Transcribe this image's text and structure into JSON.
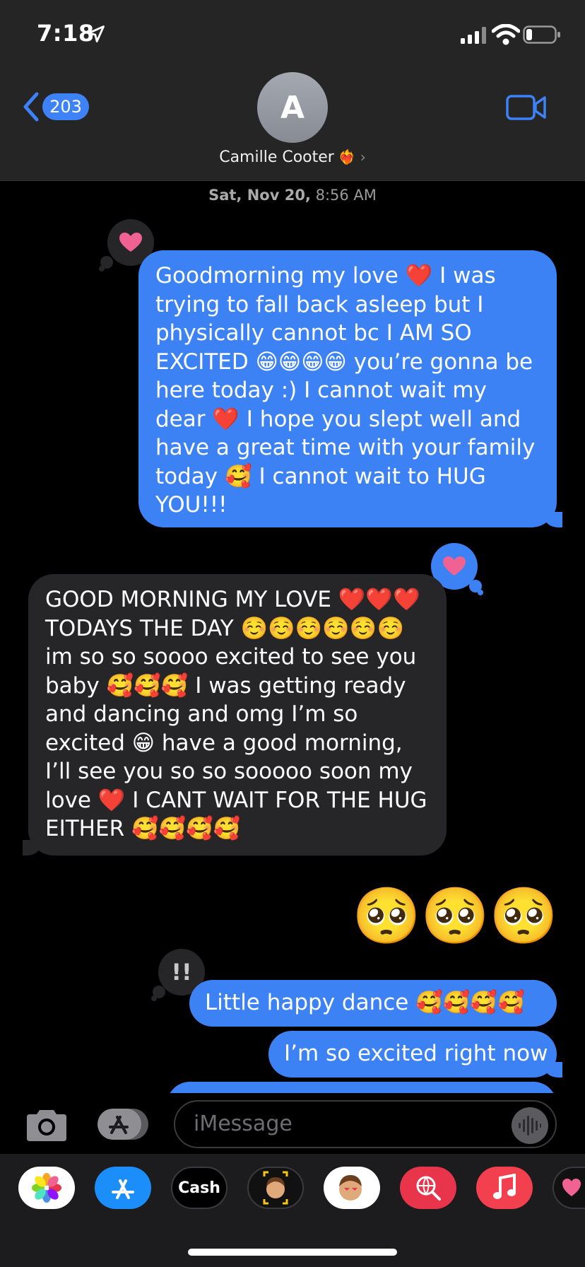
{
  "status_bar": {
    "time": "7:18"
  },
  "header": {
    "back_count": "203",
    "avatar_initial": "A",
    "contact_name": "Camille Cooter",
    "contact_emoji": "❤️‍🔥"
  },
  "thread": {
    "timestamp_date": "Sat, Nov 20,",
    "timestamp_time": "8:56 AM",
    "messages": [
      {
        "direction": "sent",
        "text": "Goodmorning my love ❤️ I was trying to fall back asleep but I physically cannot bc I AM SO EXCITED 😁😁😁😁 you’re gonna be here today :) I cannot wait my dear ❤️ I hope you slept well and have a great time with your family today 🥰 I cannot wait to HUG YOU!!!",
        "tapback": "heart"
      },
      {
        "direction": "received",
        "text": "GOOD MORNING MY LOVE ❤️❤️❤️ TODAYS THE DAY ☺️☺️☺️☺️☺️☺️ im so so soooo excited to see you baby 🥰🥰🥰 I was getting ready and dancing and omg I’m so excited 😁 have a good morning, I’ll see you so so sooooo soon my love ❤️ I CANT WAIT FOR THE HUG EITHER 🥰🥰🥰🥰",
        "tapback": "heart"
      },
      {
        "direction": "sent",
        "text": "🥺🥺🥺",
        "big_emoji": true
      },
      {
        "direction": "sent",
        "text": "Little happy dance 🥰🥰🥰🥰",
        "tapback": "exclamation"
      },
      {
        "direction": "sent",
        "text": "I’m so excited right now"
      }
    ]
  },
  "input": {
    "placeholder": "iMessage"
  },
  "drawer": {
    "apps": [
      {
        "name": "photos",
        "icon": "photos-icon",
        "color": "#ffffff"
      },
      {
        "name": "app-store",
        "icon": "app-store-icon",
        "color": "#1c8ef9"
      },
      {
        "name": "apple-cash",
        "label": "Cash",
        "icon": "apple-cash-icon",
        "color": "#000000"
      },
      {
        "name": "memoji",
        "icon": "memoji-icon",
        "color": "#111111"
      },
      {
        "name": "memoji-stickers",
        "icon": "memoji-stickers-icon",
        "color": "#ffffff"
      },
      {
        "name": "search-images",
        "icon": "images-search-icon",
        "color": "#e8354b"
      },
      {
        "name": "music",
        "icon": "music-icon",
        "color": "#f2404e"
      },
      {
        "name": "digital-touch",
        "icon": "digital-touch-icon",
        "color": "#111111"
      }
    ]
  },
  "colors": {
    "sent_bubble": "#3c82f5",
    "received_bubble": "#262628",
    "header": "#252525",
    "tapback_heart": "#f06292"
  }
}
